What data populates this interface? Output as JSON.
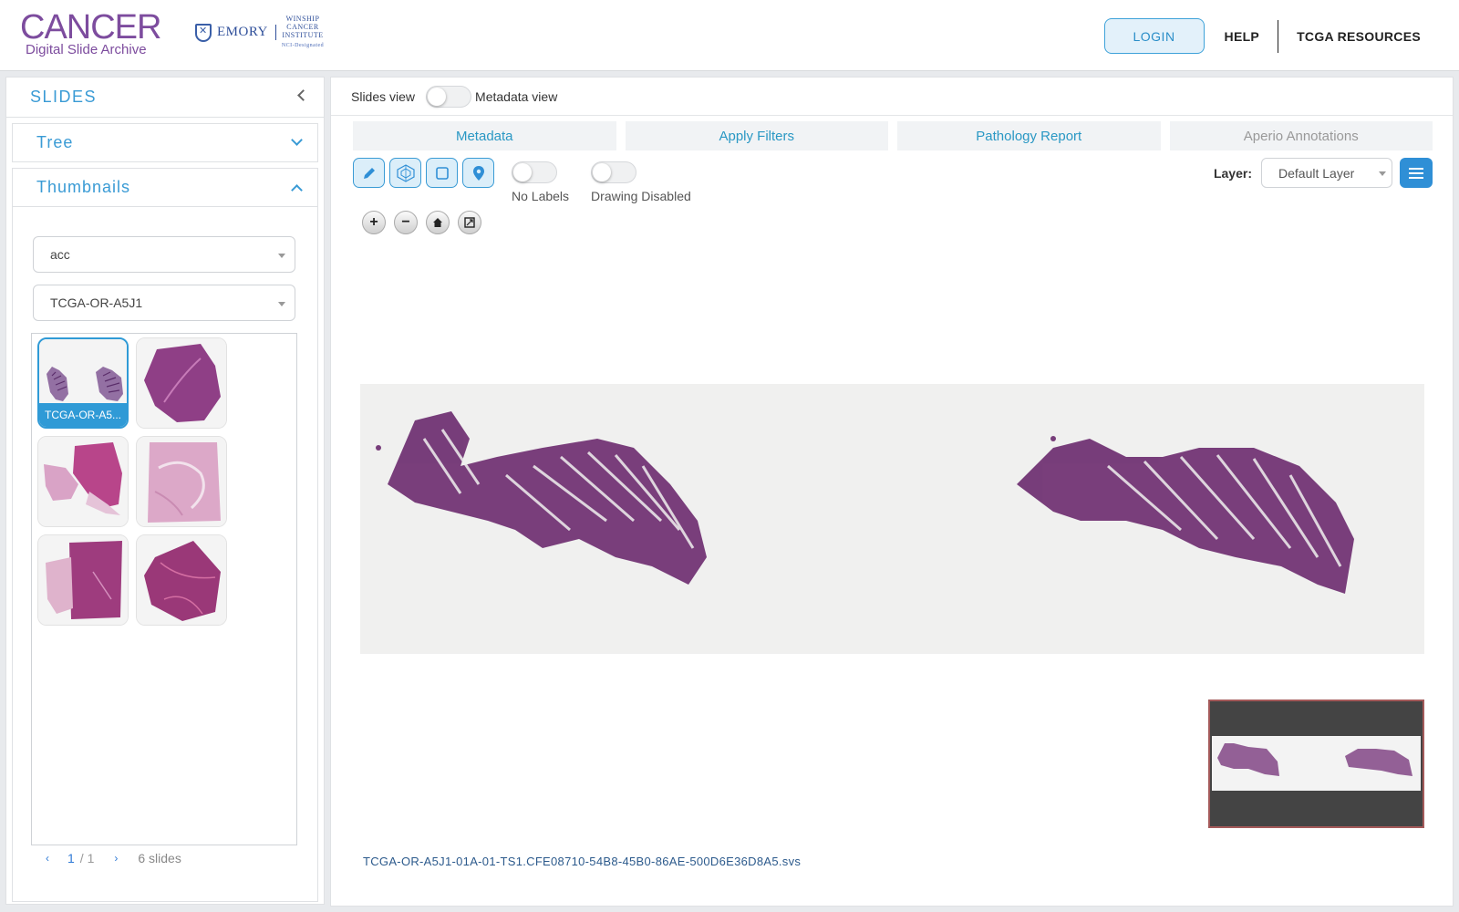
{
  "header": {
    "logo_main": "CANCER",
    "logo_sub": "Digital Slide Archive",
    "partner_name": "EMORY",
    "partner_line1": "WINSHIP",
    "partner_line2": "CANCER",
    "partner_line3": "INSTITUTE",
    "partner_badge": "NCI-Designated",
    "nav": {
      "login": "LOGIN",
      "help": "HELP",
      "resources": "TCGA RESOURCES"
    }
  },
  "sidebar": {
    "title": "SLIDES",
    "tree_label": "Tree",
    "thumbnails_label": "Thumbnails",
    "collection_select": "acc",
    "case_select": "TCGA-OR-A5J1",
    "thumbnails": [
      {
        "label": "TCGA-OR-A5...",
        "selected": true
      },
      {
        "label": "",
        "selected": false
      },
      {
        "label": "",
        "selected": false
      },
      {
        "label": "",
        "selected": false
      },
      {
        "label": "",
        "selected": false
      },
      {
        "label": "",
        "selected": false
      }
    ],
    "pager": {
      "prev": "‹",
      "current": "1",
      "total": "/ 1",
      "next": "›",
      "count": "6 slides"
    }
  },
  "viewer": {
    "slides_view_label": "Slides view",
    "metadata_view_label": "Metadata view",
    "tabs": [
      {
        "label": "Metadata",
        "disabled": false
      },
      {
        "label": "Apply Filters",
        "disabled": false
      },
      {
        "label": "Pathology Report",
        "disabled": false
      },
      {
        "label": "Aperio Annotations",
        "disabled": true
      }
    ],
    "tools": [
      "pencil-icon",
      "polygon-icon",
      "square-icon",
      "map-pin-icon"
    ],
    "labels_toggle": "No Labels",
    "drawing_toggle": "Drawing Disabled",
    "layer_label": "Layer:",
    "layer_value": "Default Layer",
    "zoom_controls": {
      "zoom_in": "+",
      "zoom_out": "−"
    },
    "filename": "TCGA-OR-A5J1-01A-01-TS1.CFE08710-54B8-45B0-86AE-500D6E36D8A5.svs"
  },
  "colors": {
    "accent": "#3a9bd5",
    "logo_purple": "#7d4c9e",
    "tissue": "#6b2a6e"
  }
}
